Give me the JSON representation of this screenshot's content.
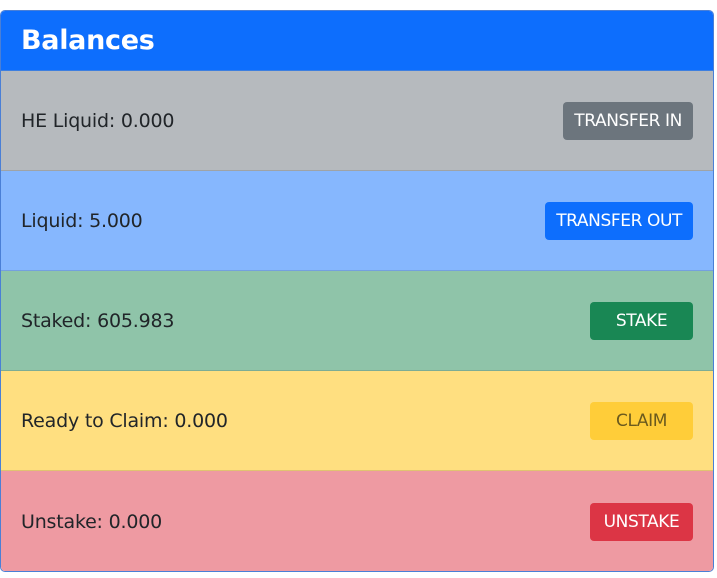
{
  "header": {
    "title": "Balances"
  },
  "rows": [
    {
      "label": "HE Liquid: 0.000",
      "button": "TRANSFER IN"
    },
    {
      "label": "Liquid: 5.000",
      "button": "TRANSFER OUT"
    },
    {
      "label": "Staked: 605.983",
      "button": "STAKE"
    },
    {
      "label": "Ready to Claim: 0.000",
      "button": "CLAIM"
    },
    {
      "label": "Unstake: 0.000",
      "button": "UNSTAKE"
    }
  ],
  "colors": {
    "header": "#0d6efd",
    "secondary": "#6c757d",
    "primary": "#0d6efd",
    "success": "#198754",
    "warning": "#ffcd39",
    "danger": "#dc3545"
  }
}
